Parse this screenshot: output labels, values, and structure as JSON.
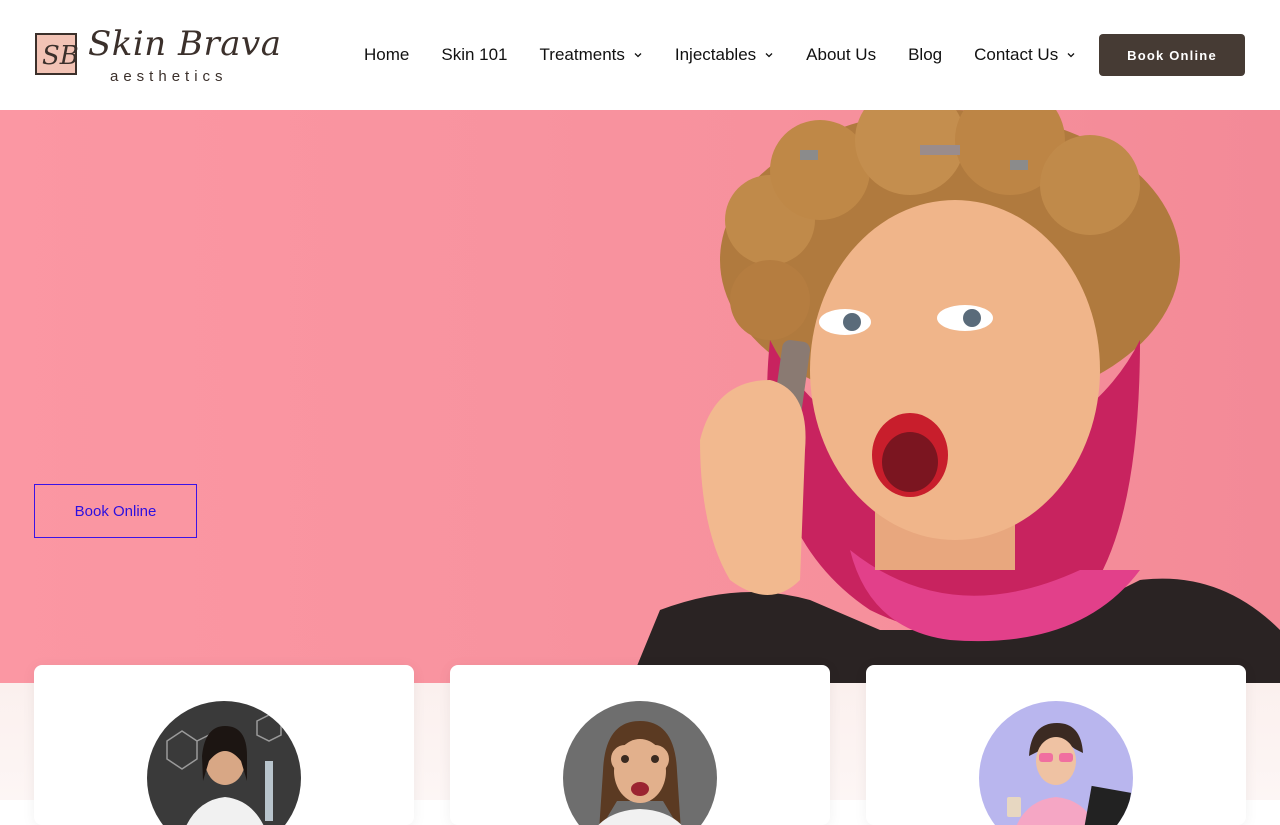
{
  "brand": {
    "name": "Skin Brava",
    "tagline": "aesthetics",
    "monogram": "SB",
    "colors": {
      "primary_dark": "#463b34",
      "hero_pink": "#f7919d",
      "link_blue": "#2b10e0"
    }
  },
  "nav": {
    "items": [
      {
        "label": "Home",
        "has_dropdown": false
      },
      {
        "label": "Skin 101",
        "has_dropdown": false
      },
      {
        "label": "Treatments",
        "has_dropdown": true
      },
      {
        "label": "Injectables",
        "has_dropdown": true
      },
      {
        "label": "About Us",
        "has_dropdown": false
      },
      {
        "label": "Blog",
        "has_dropdown": false
      },
      {
        "label": "Contact Us",
        "has_dropdown": true
      }
    ],
    "cta_label": "Book Online"
  },
  "hero": {
    "cta_label": "Book Online",
    "image": "woman-in-curlers-on-phone"
  },
  "cards": [
    {
      "image": "scientist-in-lab-coat"
    },
    {
      "image": "woman-making-goggles-with-fingers"
    },
    {
      "image": "woman-with-coffee-and-laptop"
    }
  ]
}
